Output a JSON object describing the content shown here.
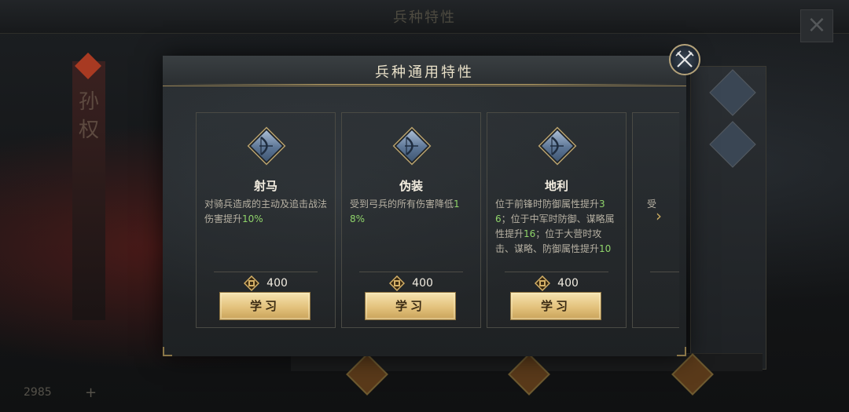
{
  "background": {
    "title": "兵种特性",
    "side_name": "孙权",
    "gold_value": "2985",
    "plus": "+",
    "close": "×"
  },
  "modal": {
    "title": "兵种通用特性",
    "cards": [
      {
        "name": "射马",
        "desc_text": "对骑兵造成的主动及追击战法伤害提升",
        "desc_highlight": "10%",
        "cost": "400",
        "button": "学习",
        "icon": "bow-icon"
      },
      {
        "name": "伪装",
        "desc_text": "受到弓兵的所有伤害降低",
        "desc_highlight": "18%",
        "cost": "400",
        "button": "学习",
        "icon": "bow-icon"
      },
      {
        "name": "地利",
        "desc_parts": [
          "位于前锋时防御属性提升",
          "36",
          "；位于中军时防御、谋略属性提升",
          "16",
          "；位于大营时攻击、谋略、防御属性提升",
          "10"
        ],
        "cost": "400",
        "button": "学习",
        "icon": "bow-icon"
      }
    ],
    "partial_card_text": "受",
    "next_arrow": "›"
  },
  "colors": {
    "accent_gold": "#c9ad6b",
    "highlight_green": "#8fd36a",
    "button_gold": "#e3c27c"
  }
}
